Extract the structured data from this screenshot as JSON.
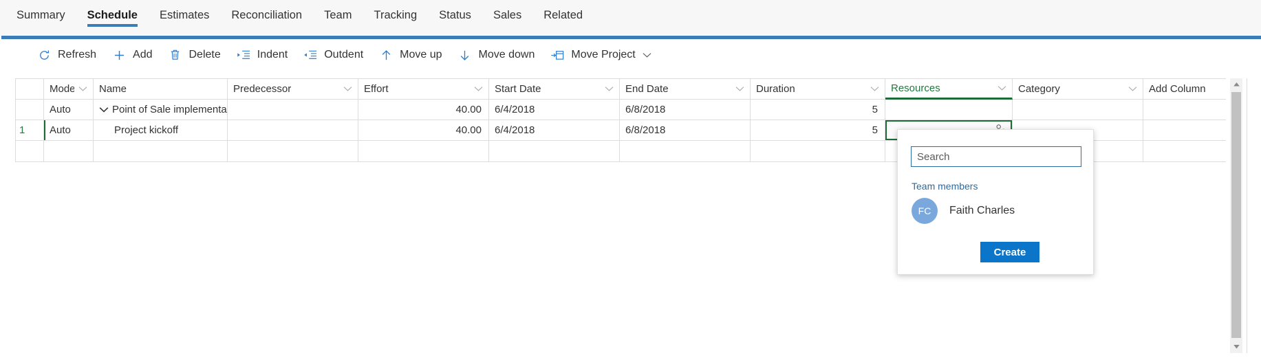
{
  "tabs": [
    {
      "label": "Summary",
      "active": false
    },
    {
      "label": "Schedule",
      "active": true
    },
    {
      "label": "Estimates",
      "active": false
    },
    {
      "label": "Reconciliation",
      "active": false
    },
    {
      "label": "Team",
      "active": false
    },
    {
      "label": "Tracking",
      "active": false
    },
    {
      "label": "Status",
      "active": false
    },
    {
      "label": "Sales",
      "active": false
    },
    {
      "label": "Related",
      "active": false
    }
  ],
  "toolbar": {
    "refresh": "Refresh",
    "add": "Add",
    "delete": "Delete",
    "indent": "Indent",
    "outdent": "Outdent",
    "move_up": "Move up",
    "move_down": "Move down",
    "move_project": "Move Project"
  },
  "grid": {
    "columns": [
      {
        "key": "rownum",
        "label": "",
        "caret": false
      },
      {
        "key": "mode",
        "label": "Mode",
        "caret": true
      },
      {
        "key": "name",
        "label": "Name",
        "caret": false
      },
      {
        "key": "pred",
        "label": "Predecessor",
        "caret": true
      },
      {
        "key": "effort",
        "label": "Effort",
        "caret": true
      },
      {
        "key": "start",
        "label": "Start Date",
        "caret": true
      },
      {
        "key": "end",
        "label": "End Date",
        "caret": true
      },
      {
        "key": "duration",
        "label": "Duration",
        "caret": true
      },
      {
        "key": "res",
        "label": "Resources",
        "caret": true
      },
      {
        "key": "category",
        "label": "Category",
        "caret": true
      },
      {
        "key": "addcol",
        "label": "Add Column",
        "caret": false
      }
    ],
    "selected_column": "Resources",
    "selected_column_color": "#1f7a3d",
    "rows": [
      {
        "rownum": "",
        "mode": "Auto",
        "name": "Point of Sale implementatio",
        "pred": "",
        "effort": "40.00",
        "start": "6/4/2018",
        "end": "6/8/2018",
        "duration": "5",
        "res": "",
        "category": "",
        "addcol": ""
      },
      {
        "rownum": "1",
        "mode": "Auto",
        "name": "Project kickoff",
        "pred": "",
        "effort": "40.00",
        "start": "6/4/2018",
        "end": "6/8/2018",
        "duration": "5",
        "res": "",
        "category": "",
        "addcol": ""
      },
      {
        "rownum": "",
        "mode": "",
        "name": "",
        "pred": "",
        "effort": "",
        "start": "",
        "end": "",
        "duration": "",
        "res": "",
        "category": "",
        "addcol": ""
      }
    ]
  },
  "resource_popup": {
    "search_placeholder": "Search",
    "search_value": "",
    "section_label": "Team members",
    "members": [
      {
        "initials": "FC",
        "name": "Faith Charles",
        "avatar_color": "#7aa8dd"
      }
    ],
    "create_label": "Create"
  },
  "colors": {
    "accent_blue": "#3a7cb8",
    "link_blue": "#2b6ca3",
    "button_blue": "#0b76c9",
    "selection_green": "#1c6b35",
    "header_green": "#1f7a3d"
  }
}
